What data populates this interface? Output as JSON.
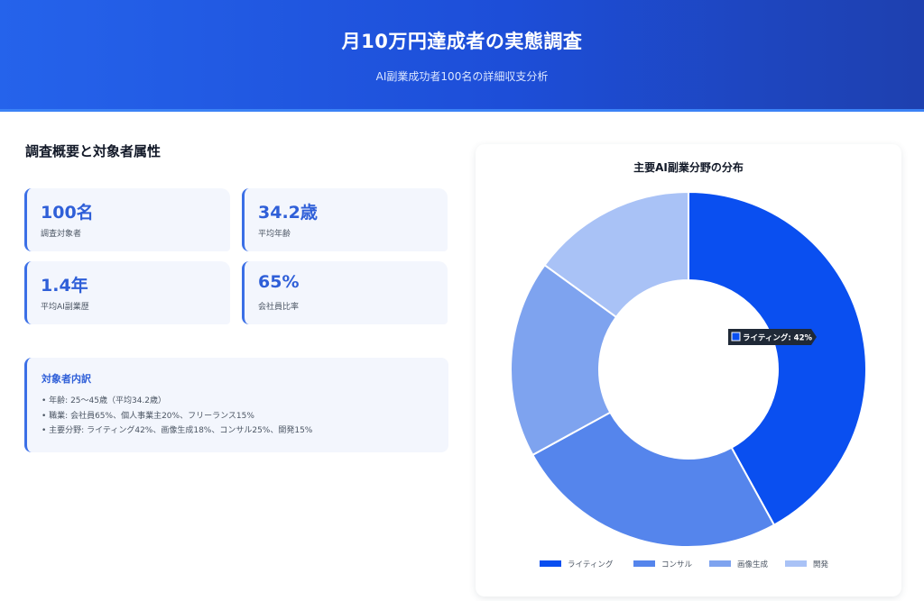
{
  "header": {
    "title": "月10万円達成者の実態調査",
    "subtitle": "AI副業成功者100名の詳細収支分析"
  },
  "overview": {
    "title": "調査概要と対象者属性",
    "stats": [
      {
        "value": "100名",
        "label": "調査対象者"
      },
      {
        "value": "34.2歳",
        "label": "平均年齢"
      },
      {
        "value": "1.4年",
        "label": "平均AI副業歴"
      },
      {
        "value": "65%",
        "label": "会社員比率"
      }
    ]
  },
  "breakdown": {
    "title": "対象者内訳",
    "items": [
      "• 年齢: 25〜45歳（平均34.2歳）",
      "• 職業: 会社員65%、個人事業主20%、フリーランス15%",
      "• 主要分野: ライティング42%、画像生成18%、コンサル25%、開発15%"
    ]
  },
  "chart_data": {
    "type": "pie",
    "title": "主要AI副業分野の分布",
    "categories": [
      "ライティング",
      "コンサル",
      "画像生成",
      "開発"
    ],
    "values": [
      42,
      25,
      18,
      15
    ],
    "colors": [
      "#0a4ff0",
      "#5585ec",
      "#7ea3ef",
      "#a9c2f6"
    ],
    "legend_position": "bottom",
    "tooltip": {
      "category": "ライティング",
      "text": "ライティング: 42%"
    }
  }
}
